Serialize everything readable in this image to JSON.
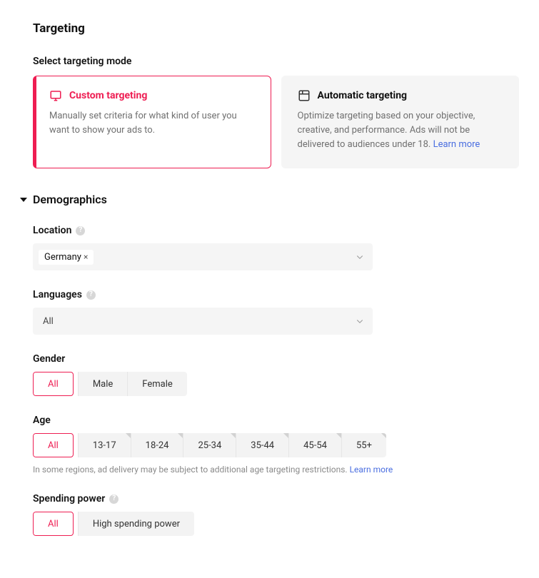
{
  "header": {
    "title": "Targeting"
  },
  "targeting_mode": {
    "label": "Select targeting mode",
    "custom": {
      "title": "Custom targeting",
      "desc": "Manually set criteria for what kind of user you want to show your ads to."
    },
    "automatic": {
      "title": "Automatic targeting",
      "desc": "Optimize targeting based on your objective, creative, and performance. Ads will not be delivered to audiences under 18. ",
      "learn_more": "Learn more"
    }
  },
  "demographics": {
    "title": "Demographics",
    "location": {
      "label": "Location",
      "selected_chip": "Germany"
    },
    "languages": {
      "label": "Languages",
      "value": "All"
    },
    "gender": {
      "label": "Gender",
      "options": [
        "All",
        "Male",
        "Female"
      ],
      "selected": "All"
    },
    "age": {
      "label": "Age",
      "options": [
        "All",
        "13-17",
        "18-24",
        "25-34",
        "35-44",
        "45-54",
        "55+"
      ],
      "selected": "All",
      "hint_text": "In some regions, ad delivery may be subject to additional age targeting restrictions. ",
      "hint_link": "Learn more"
    },
    "spending_power": {
      "label": "Spending power",
      "options": [
        "All",
        "High spending power"
      ],
      "selected": "All"
    }
  }
}
